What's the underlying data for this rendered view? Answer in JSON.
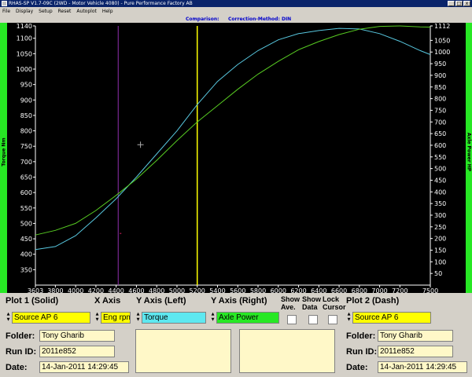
{
  "window": {
    "title": "RHAS-SP V1.7-09C  (2WD - Motor Vehicle 4080) - Pure Performance Factory AB",
    "buttons": [
      "_",
      "□",
      "x"
    ]
  },
  "menu": [
    "File",
    "Display",
    "Setup",
    "Reset",
    "Autoplot",
    "Help"
  ],
  "comparison": {
    "label": "Comparison:",
    "method": "Correction-Method: DIN"
  },
  "axis_titles": {
    "left": "Torque Nm",
    "right": "Axle Power HP"
  },
  "colors": {
    "torque": "#58c8e0",
    "power": "#58cc22",
    "cursor_yellow": "#ffff00",
    "cursor_purple": "#9030b0",
    "strip": "#27e824",
    "memo": "#fff8c8"
  },
  "chart_data": {
    "type": "line",
    "x": [
      3603,
      3800,
      4000,
      4200,
      4400,
      4600,
      4800,
      5000,
      5200,
      5400,
      5600,
      5800,
      6000,
      6200,
      6400,
      6600,
      6800,
      7000,
      7200,
      7400,
      7500
    ],
    "xticks": [
      "3603",
      "3800",
      "4000",
      "4200",
      "4400",
      "4600",
      "4800",
      "5000",
      "5200",
      "5400",
      "5600",
      "5800",
      "6000",
      "6200",
      "6400",
      "6600",
      "6800",
      "7000",
      "7200",
      "7500"
    ],
    "xlim": [
      3603,
      7500
    ],
    "series": [
      {
        "name": "Torque",
        "axis": "left",
        "style": "solid",
        "values": [
          415,
          425,
          460,
          518,
          580,
          650,
          725,
          800,
          885,
          960,
          1015,
          1060,
          1095,
          1115,
          1125,
          1132,
          1130,
          1115,
          1090,
          1060,
          1047
        ]
      },
      {
        "name": "Axle Power",
        "axis": "right",
        "style": "solid",
        "values": [
          215,
          235,
          265,
          320,
          385,
          455,
          535,
          620,
          700,
          770,
          840,
          905,
          960,
          1010,
          1045,
          1075,
          1098,
          1110,
          1112,
          1108,
          1107
        ]
      }
    ],
    "y_left": {
      "ylim": [
        300,
        1140
      ],
      "ticks": [
        350,
        400,
        450,
        500,
        550,
        600,
        650,
        700,
        750,
        800,
        850,
        900,
        950,
        1000,
        1050,
        1100,
        1140
      ],
      "label": "Torque Nm"
    },
    "y_right": {
      "ylim": [
        0,
        1112
      ],
      "ticks": [
        50,
        100,
        150,
        200,
        250,
        300,
        350,
        400,
        450,
        500,
        550,
        600,
        650,
        700,
        750,
        800,
        850,
        900,
        950,
        1000,
        1050,
        1112
      ],
      "label": "Axle Power HP"
    },
    "cursors": [
      {
        "x": 4420,
        "color": "purple"
      },
      {
        "x": 5200,
        "color": "yellow"
      }
    ],
    "crosshair": {
      "x": 4640,
      "y_left": 755
    },
    "grid": false
  },
  "panel": {
    "plot1_label": "Plot 1 (Solid)",
    "x_axis_label": "X Axis",
    "y_left_label": "Y Axis (Left)",
    "y_right_label": "Y Axis (Right)",
    "show_ave_label": "Show Ave.",
    "show_data_label": "Show Data",
    "lock_cursor_label": "Lock Cursor",
    "plot2_label": "Plot 2 (Dash)",
    "plot1_source": "Source AP 6",
    "x_axis_value": "Eng rpm",
    "y_left_value": "Torque",
    "y_right_value": "Axle Power",
    "plot2_source": "Source AP 6",
    "plot1_info": {
      "folder_label": "Folder:",
      "folder": "Tony Gharib",
      "runid_label": "Run ID:",
      "runid": "2011e852",
      "date_label": "Date:",
      "date": "14-Jan-2011   14:29:45"
    },
    "plot2_info": {
      "folder_label": "Folder:",
      "folder": "Tony Gharib",
      "runid_label": "Run ID:",
      "runid": "2011e852",
      "date_label": "Date:",
      "date": "14-Jan-2011   14:29:45"
    }
  }
}
